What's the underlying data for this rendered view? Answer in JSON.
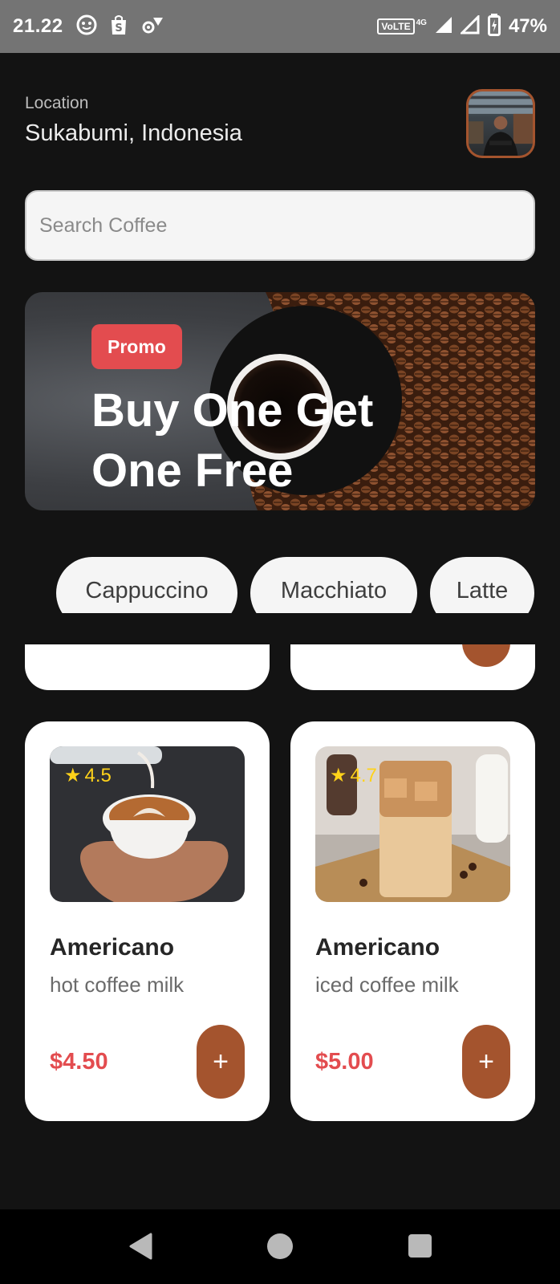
{
  "status_bar": {
    "time": "21.22",
    "network_label": "VoLTE",
    "network_gen": "4G",
    "battery_percent": "47%",
    "icons": [
      "face-notification-icon",
      "shop-bag-icon",
      "settings-icon",
      "wifi-icon",
      "signal-icon",
      "battery-icon"
    ]
  },
  "header": {
    "location_label": "Location",
    "location_value": "Sukabumi, Indonesia"
  },
  "search": {
    "placeholder": "Search Coffee"
  },
  "banner": {
    "badge": "Promo",
    "title": "Buy One Get One Free"
  },
  "categories": [
    {
      "label": "Cappuccino"
    },
    {
      "label": "Macchiato"
    },
    {
      "label": "Latte"
    }
  ],
  "products": [
    {
      "name": "Americano",
      "description": "hot coffee milk",
      "price": "$4.50",
      "rating": "4.5",
      "add_label": "+"
    },
    {
      "name": "Americano",
      "description": "iced coffee milk",
      "price": "$5.00",
      "rating": "4.7",
      "add_label": "+"
    }
  ],
  "colors": {
    "background": "#131313",
    "accent": "#a4542e",
    "price": "#e34c4f",
    "promo_badge": "#e34c4f",
    "rating_star": "#ffd21a",
    "card": "#ffffff"
  }
}
